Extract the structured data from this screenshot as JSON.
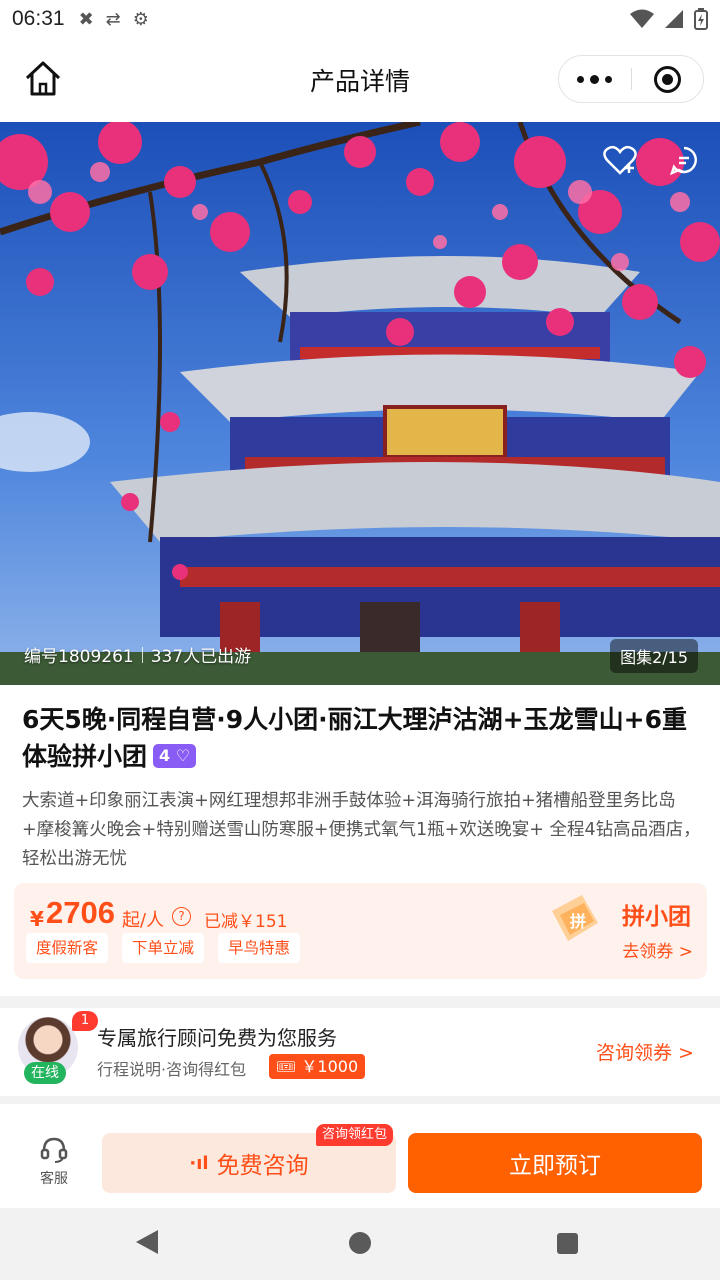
{
  "status_bar": {
    "time": "06:31"
  },
  "nav": {
    "title": "产品详情"
  },
  "hero": {
    "product_code": "编号1809261",
    "travelers": "337人已出游",
    "gallery": "图集2/15"
  },
  "product": {
    "title": "6天5晚·同程自营·9人小团·丽江大理泸沽湖+玉龙雪山+6重体验拼小团",
    "level_badge": "4",
    "description": "大索道+印象丽江表演+网红理想邦非洲手鼓体验+洱海骑行旅拍+猪槽船登里务比岛+摩梭篝火晚会+特别赠送雪山防寒服+便携式氧气1瓶+欢送晚宴+ 全程4钻高品酒店，轻松出游无忧"
  },
  "price": {
    "currency": "¥",
    "amount": "2706",
    "unit": "起/人",
    "help": "?",
    "saved": "已减￥151",
    "tags": [
      "度假新客",
      "下单立减",
      "早鸟特惠"
    ],
    "group_label": "拼小团",
    "group_link": "去领券 >"
  },
  "advisor": {
    "badge": "1",
    "online": "在线",
    "title": "专属旅行顾问免费为您服务",
    "subtitle": "行程说明·咨询得红包",
    "coupon": "￥1000",
    "action": "咨询领券 >"
  },
  "bottom": {
    "service_label": "客服",
    "consult_tag": "咨询领红包",
    "consult_label": "免费咨询",
    "book_label": "立即预订"
  },
  "colors": {
    "accent": "#ff4f19",
    "book": "#ff6000",
    "consult_bg": "#fde8dd",
    "level": "#8a5cf6",
    "online": "#23b45e"
  }
}
